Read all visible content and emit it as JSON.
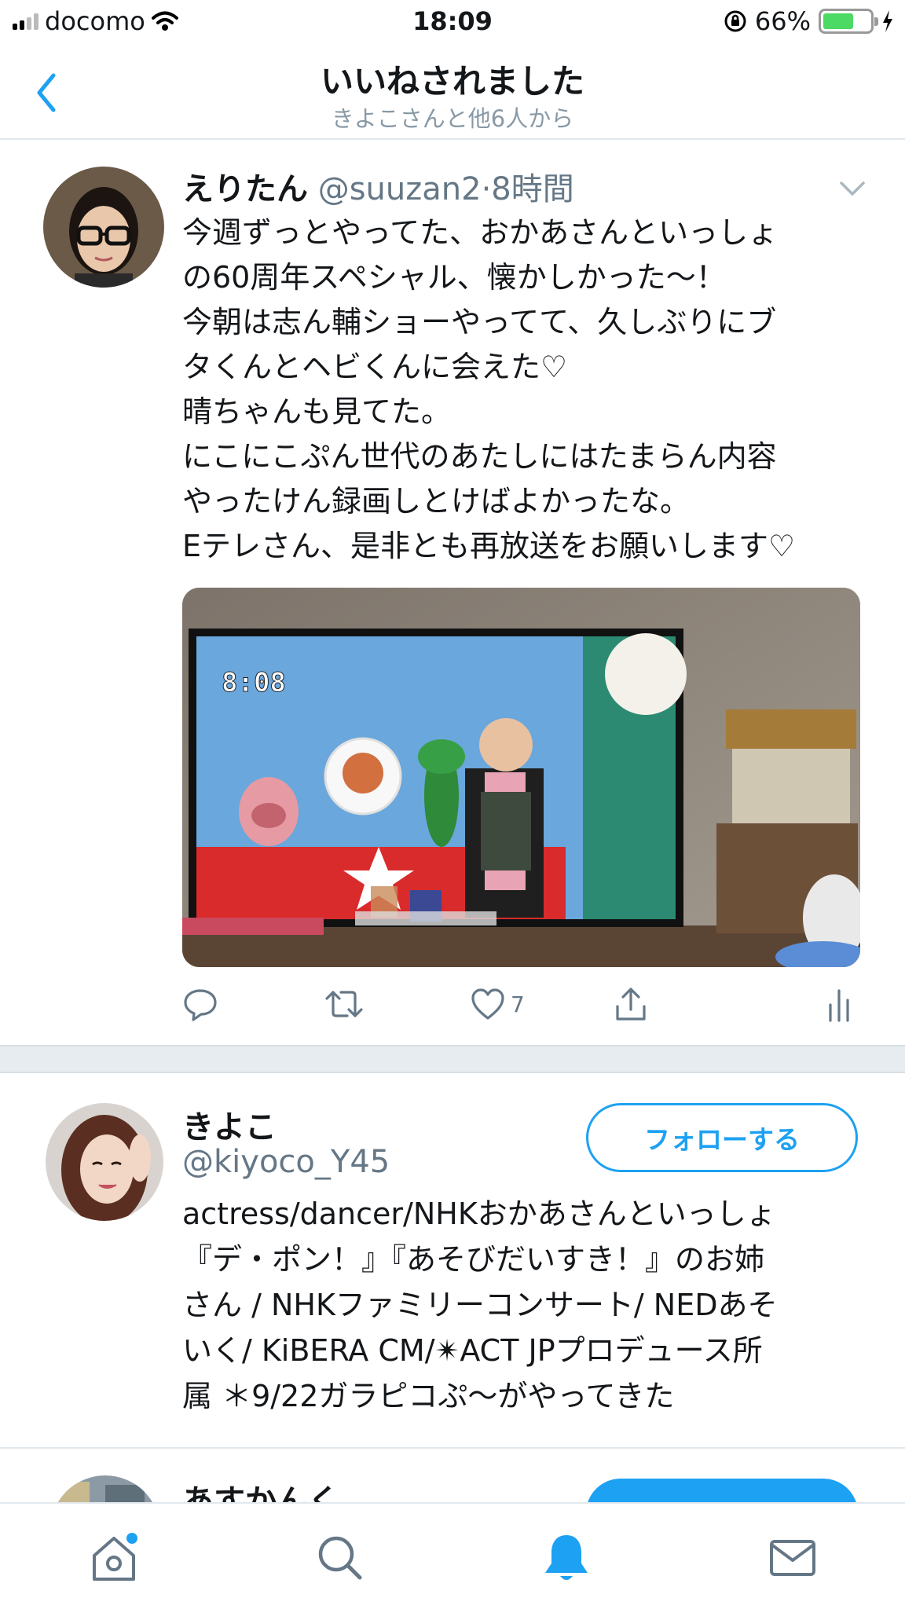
{
  "status_bar": {
    "carrier": "docomo",
    "time": "18:09",
    "battery": "66%",
    "battery_level": 0.66
  },
  "header": {
    "title": "いいねされました",
    "subtitle": "きよこさんと他6人から"
  },
  "tweet": {
    "name": "えりたん",
    "handle": "@suuzan2",
    "time": "·8時間",
    "text": "今週ずっとやってた、おかあさんといっしょ\nの60周年スペシャル、懐かしかった〜！\n今朝は志ん輔ショーやってて、久しぶりにブ\nタくんとヘビくんに会えた♡\n晴ちゃんも見てた。\nにこにこぷん世代のあたしにはたまらん内容\nやったけん録画しとけばよかったな。\nEテレさん、是非とも再放送をお願いします♡",
    "tv_clock": "8:08",
    "like_count": "7",
    "icons": [
      "reply-icon",
      "retweet-icon",
      "like-icon",
      "share-icon",
      "analytics-icon"
    ]
  },
  "users": [
    {
      "name": "きよこ",
      "handle": "@kiyoco_Y45",
      "follow_label": "フォローする",
      "bio": "actress/dancer/NHKおかあさんといっしょ\n『デ・ポン！』『あそびだいすき！』のお姉\nさん / NHKファミリーコンサート/ NEDあそ\nいく/ KiBERA CM/✴ACT JPプロデュース所\n属 ＊9/22ガラピコぷ〜がやってきた"
    },
    {
      "name": "あすかんく"
    }
  ],
  "tab_bar": {
    "tabs": [
      "home-icon",
      "search-icon",
      "notifications-icon",
      "messages-icon"
    ],
    "active": "notifications-icon",
    "colors": {
      "accent": "#1da1f2",
      "inactive": "#657786"
    }
  }
}
